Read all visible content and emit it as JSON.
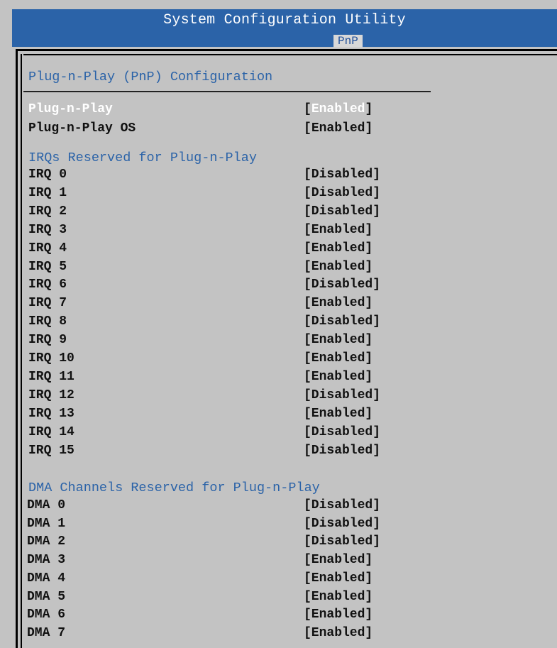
{
  "header": {
    "title": "System Configuration Utility",
    "tab": "PnP"
  },
  "page": {
    "title": "Plug-n-Play (PnP) Configuration"
  },
  "pnp": [
    {
      "label": "Plug-n-Play",
      "value": "Enabled"
    },
    {
      "label": "Plug-n-Play OS",
      "value": "Enabled"
    }
  ],
  "irq_heading": "IRQs Reserved for Plug-n-Play",
  "irqs": [
    {
      "label": "IRQ 0",
      "value": "[Disabled]"
    },
    {
      "label": "IRQ 1",
      "value": "[Disabled]"
    },
    {
      "label": "IRQ 2",
      "value": "[Disabled]"
    },
    {
      "label": "IRQ 3",
      "value": "[Enabled]"
    },
    {
      "label": "IRQ 4",
      "value": "[Enabled]"
    },
    {
      "label": "IRQ 5",
      "value": "[Enabled]"
    },
    {
      "label": "IRQ 6",
      "value": "[Disabled]"
    },
    {
      "label": "IRQ 7",
      "value": "[Enabled]"
    },
    {
      "label": "IRQ 8",
      "value": "[Disabled]"
    },
    {
      "label": "IRQ 9",
      "value": "[Enabled]"
    },
    {
      "label": "IRQ 10",
      "value": "[Enabled]"
    },
    {
      "label": "IRQ 11",
      "value": "[Enabled]"
    },
    {
      "label": "IRQ 12",
      "value": "[Disabled]"
    },
    {
      "label": "IRQ 13",
      "value": "[Enabled]"
    },
    {
      "label": "IRQ 14",
      "value": "[Disabled]"
    },
    {
      "label": "IRQ 15",
      "value": "[Disabled]"
    }
  ],
  "dma_heading": "DMA Channels Reserved for Plug-n-Play",
  "dmas": [
    {
      "label": "DMA 0",
      "value": "[Disabled]"
    },
    {
      "label": "DMA 1",
      "value": "[Disabled]"
    },
    {
      "label": "DMA 2",
      "value": "[Disabled]"
    },
    {
      "label": "DMA 3",
      "value": "[Enabled]"
    },
    {
      "label": "DMA 4",
      "value": "[Enabled]"
    },
    {
      "label": "DMA 5",
      "value": "[Enabled]"
    },
    {
      "label": "DMA 6",
      "value": "[Enabled]"
    },
    {
      "label": "DMA 7",
      "value": "[Enabled]"
    }
  ]
}
